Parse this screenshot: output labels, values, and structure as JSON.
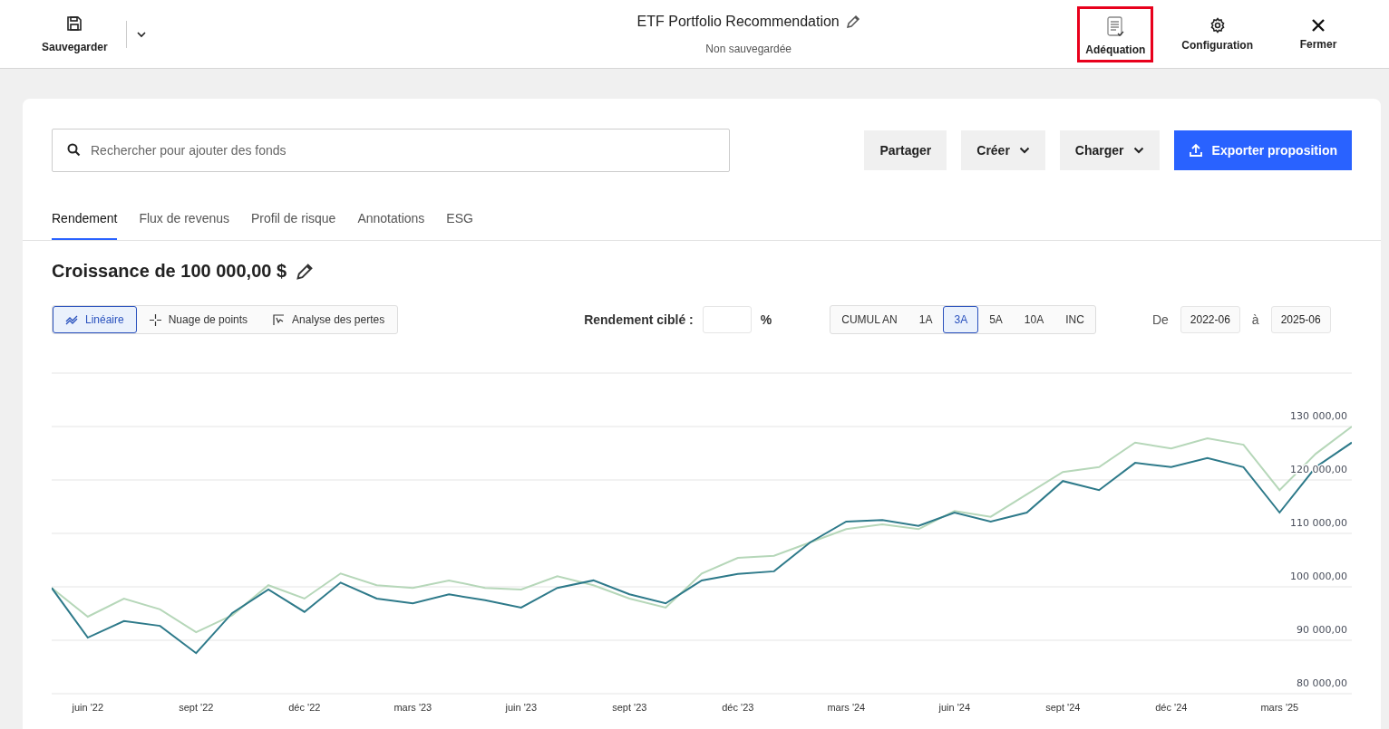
{
  "header": {
    "save": {
      "label": "Sauvegarder"
    },
    "title": "ETF Portfolio Recommendation",
    "subtitle": "Non sauvegardée",
    "actions": [
      {
        "kind": "suitability",
        "label": "Adéquation",
        "highlighted": true
      },
      {
        "kind": "settings",
        "label": "Configuration",
        "highlighted": false
      },
      {
        "kind": "close",
        "label": "Fermer",
        "highlighted": false
      }
    ]
  },
  "search": {
    "placeholder": "Rechercher pour ajouter des fonds"
  },
  "buttons": [
    {
      "label": "Partager",
      "kind": "plain"
    },
    {
      "label": "Créer",
      "kind": "dropdown"
    },
    {
      "label": "Charger",
      "kind": "dropdown"
    },
    {
      "label": "Exporter proposition",
      "kind": "primary"
    }
  ],
  "tabs": [
    {
      "label": "Rendement",
      "selected": true
    },
    {
      "label": "Flux de revenus",
      "selected": false
    },
    {
      "label": "Profil de risque",
      "selected": false
    },
    {
      "label": "Annotations",
      "selected": false
    },
    {
      "label": "ESG",
      "selected": false
    }
  ],
  "section_title": "Croissance de 100 000,00 $",
  "chart_types": [
    {
      "kind": "line",
      "label": "Linéaire",
      "selected": true
    },
    {
      "kind": "scatter",
      "label": "Nuage de points",
      "selected": false
    },
    {
      "kind": "drawdown",
      "label": "Analyse des pertes",
      "selected": false
    }
  ],
  "target_return": {
    "label": "Rendement ciblé :",
    "unit": "%"
  },
  "periods": [
    {
      "label": "CUMUL AN",
      "selected": false
    },
    {
      "label": "1A",
      "selected": false
    },
    {
      "label": "3A",
      "selected": true
    },
    {
      "label": "5A",
      "selected": false
    },
    {
      "label": "10A",
      "selected": false
    },
    {
      "label": "INC",
      "selected": false
    }
  ],
  "date_range": {
    "from_label": "De",
    "from": "2022-06",
    "to_label": "à",
    "to": "2025-06"
  },
  "chart_data": {
    "type": "line",
    "categories": [
      null,
      "juin '22",
      null,
      null,
      "sept '22",
      null,
      null,
      "déc '22",
      null,
      null,
      "mars '23",
      null,
      null,
      "juin '23",
      null,
      null,
      "sept '23",
      null,
      null,
      "déc '23",
      null,
      null,
      "mars '24",
      null,
      null,
      "juin '24",
      null,
      null,
      "sept '24",
      null,
      null,
      "déc '24",
      null,
      null,
      "mars '25",
      null,
      null
    ],
    "series": [
      {
        "color": "#b6d7b9",
        "values": [
          99800,
          94400,
          97800,
          95800,
          91500,
          94700,
          100300,
          97800,
          102500,
          100300,
          99800,
          101200,
          99800,
          99500,
          102000,
          100300,
          97800,
          96100,
          102500,
          105400,
          105800,
          108300,
          110800,
          111700,
          110800,
          114200,
          113100,
          117300,
          121500,
          122400,
          127000,
          125900,
          127800,
          126600,
          118100,
          124900,
          130000
        ]
      },
      {
        "color": "#2e7a8a",
        "values": [
          99800,
          90500,
          93600,
          92700,
          87600,
          95100,
          99500,
          95300,
          100800,
          97800,
          96900,
          98600,
          97500,
          96100,
          99800,
          101200,
          98600,
          96900,
          101200,
          102400,
          102900,
          108300,
          112200,
          112500,
          111400,
          113900,
          112200,
          113900,
          119800,
          118100,
          123200,
          122400,
          124100,
          122400,
          113900,
          122400,
          127000
        ]
      }
    ],
    "ylim": [
      80000,
      140000
    ],
    "grid": true,
    "yticks": [
      {
        "value": 80000,
        "label": "80 000,00"
      },
      {
        "value": 90000,
        "label": "90 000,00"
      },
      {
        "value": 100000,
        "label": "100 000,00"
      },
      {
        "value": 110000,
        "label": "110 000,00"
      },
      {
        "value": 120000,
        "label": "120 000,00"
      },
      {
        "value": 130000,
        "label": "130 000,00"
      }
    ]
  }
}
